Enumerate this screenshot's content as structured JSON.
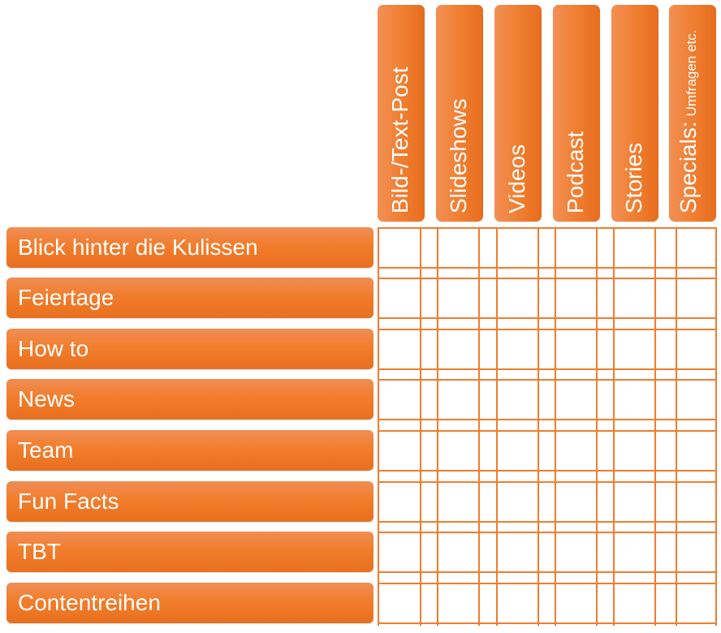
{
  "colors": {
    "accent": "#f07d2e",
    "label_text": "#ffffff",
    "background": "#ffffff"
  },
  "columns": [
    {
      "label": "Bild-/Text-Post",
      "sub": ""
    },
    {
      "label": "Slideshows",
      "sub": ""
    },
    {
      "label": "Videos",
      "sub": ""
    },
    {
      "label": "Podcast",
      "sub": ""
    },
    {
      "label": "Stories",
      "sub": ""
    },
    {
      "label": "Specials:",
      "sub": "Umfragen etc."
    }
  ],
  "rows": [
    {
      "label": "Blick hinter die Kulissen"
    },
    {
      "label": "Feiertage"
    },
    {
      "label": "How to"
    },
    {
      "label": "News"
    },
    {
      "label": "Team"
    },
    {
      "label": "Fun Facts"
    },
    {
      "label": "TBT"
    },
    {
      "label": "Contentreihen"
    }
  ]
}
